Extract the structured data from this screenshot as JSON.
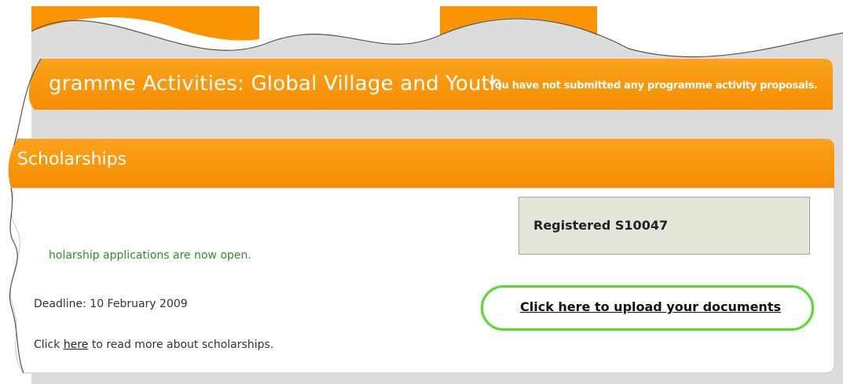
{
  "programme_panel": {
    "title": "gramme Activities: Global Village and Youth",
    "status": "You have not submitted any programme activity proposals."
  },
  "scholarships_panel": {
    "title": "Scholarships",
    "open_notice": "holarship applications are now open.",
    "deadline": "Deadline: 10 February 2009",
    "read_more": {
      "prefix": "Click ",
      "link": "here",
      "suffix": " to read more about scholarships."
    },
    "registration": "Registered S10047",
    "upload_link": "Click here to upload your documents"
  },
  "colors": {
    "header_orange": "#fb9402",
    "page_gray": "#dcdcdc",
    "highlight_green": "#5ed63a",
    "notice_green": "#2e8f2e"
  }
}
